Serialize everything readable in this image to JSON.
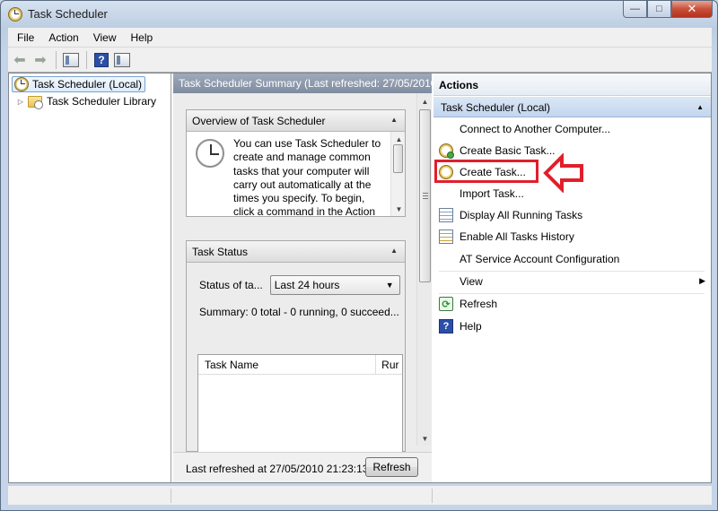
{
  "window": {
    "title": "Task Scheduler"
  },
  "menu": {
    "items": [
      "File",
      "Action",
      "View",
      "Help"
    ]
  },
  "tree": {
    "root": "Task Scheduler (Local)",
    "child": "Task Scheduler Library"
  },
  "center": {
    "header": "Task Scheduler Summary (Last refreshed: 27/05/2010",
    "overview": {
      "title": "Overview of Task Scheduler",
      "text": "You can use Task Scheduler to create and manage common tasks that your computer will carry out automatically at the times you specify. To begin, click a command in the Action"
    },
    "status": {
      "title": "Task Status",
      "label": "Status of ta...",
      "select_value": "Last 24 hours",
      "summary": "Summary: 0 total - 0 running, 0 succeed...",
      "columns": [
        "Task Name",
        "Rur"
      ]
    },
    "footer": {
      "text": "Last refreshed at 27/05/2010 21:23:13",
      "refresh_label": "Refresh"
    }
  },
  "actions": {
    "title": "Actions",
    "group": "Task Scheduler (Local)",
    "items": [
      {
        "label": "Connect to Another Computer...",
        "icon": "none"
      },
      {
        "label": "Create Basic Task...",
        "icon": "clock-add-icon"
      },
      {
        "label": "Create Task...",
        "icon": "clock-icon"
      },
      {
        "label": "Import Task...",
        "icon": "none"
      },
      {
        "label": "Display All Running Tasks",
        "icon": "list-icon"
      },
      {
        "label": "Enable All Tasks History",
        "icon": "history-icon"
      },
      {
        "label": "AT Service Account Configuration",
        "icon": "none"
      },
      {
        "label": "View",
        "icon": "none"
      },
      {
        "label": "Refresh",
        "icon": "refresh-icon"
      },
      {
        "label": "Help",
        "icon": "help-icon"
      }
    ]
  },
  "annotation": {
    "color": "#e11f2b"
  }
}
